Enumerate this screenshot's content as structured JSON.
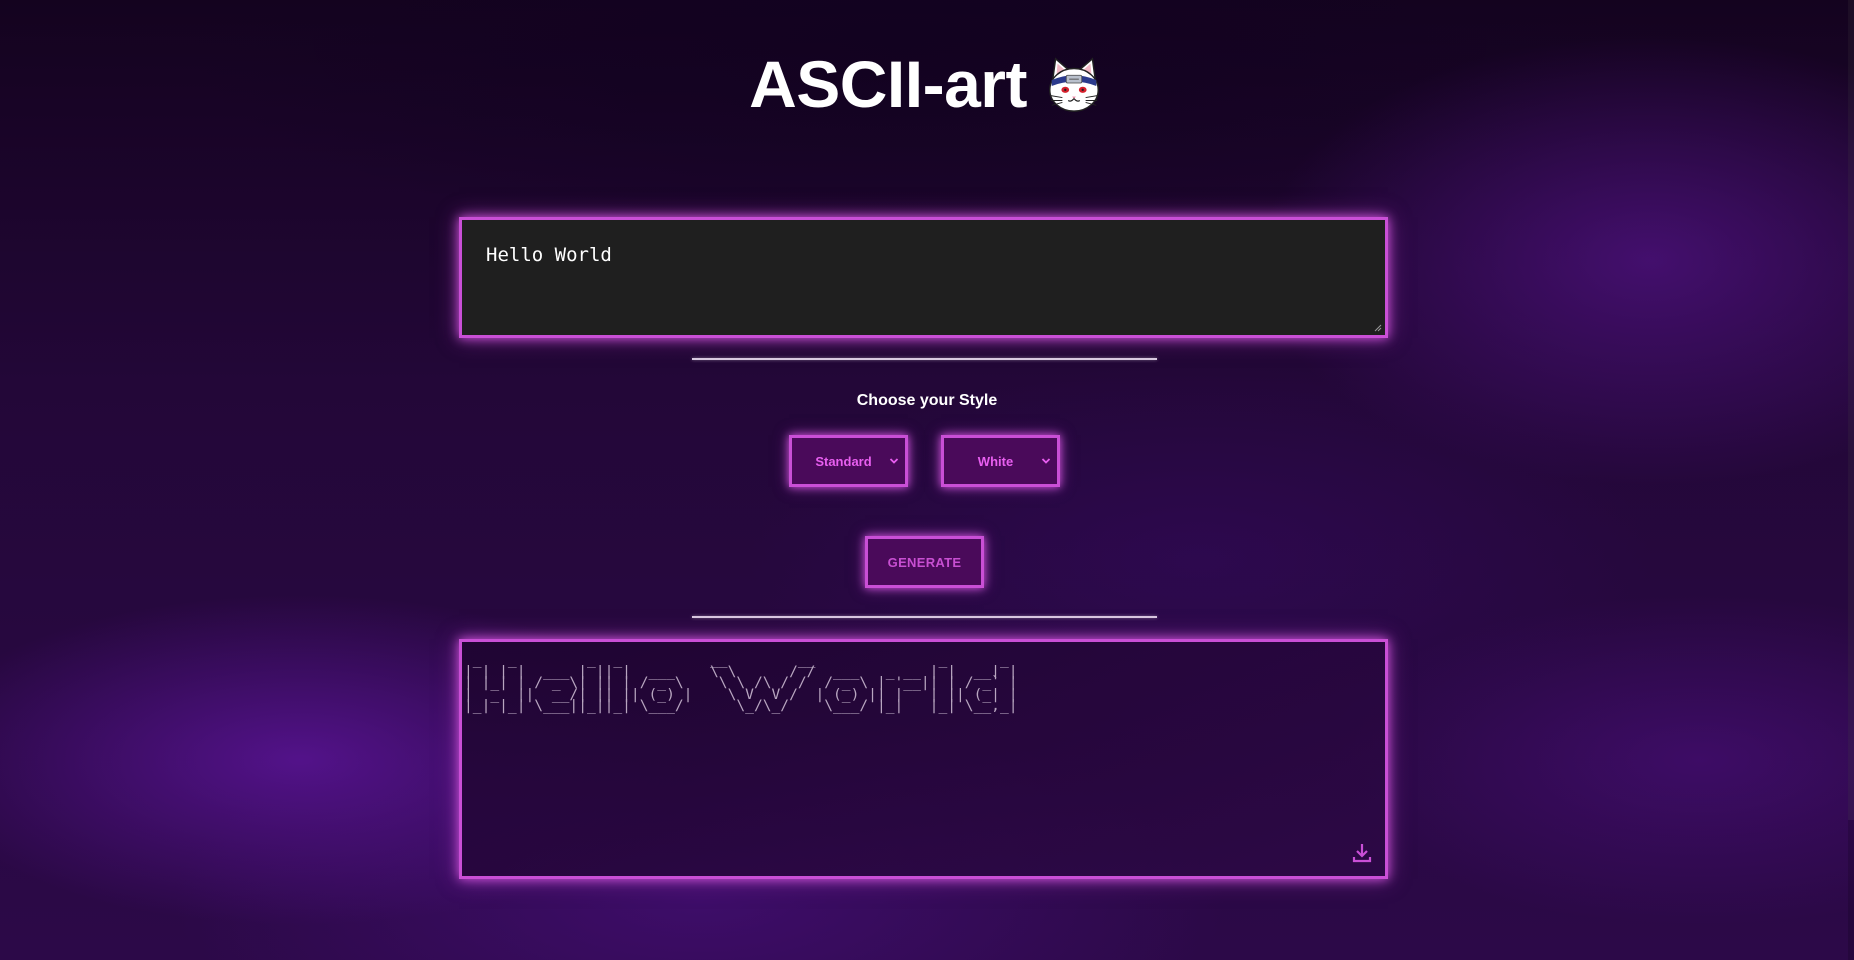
{
  "header": {
    "title": "ASCII-art",
    "logo_icon": "cat-face-icon"
  },
  "input": {
    "value": "Hello World"
  },
  "style_section": {
    "label": "Choose your Style",
    "font_select": {
      "selected": "Standard"
    },
    "color_select": {
      "selected": "White"
    }
  },
  "generate_button": {
    "label": "GENERATE"
  },
  "output": {
    "ascii_text": " _   _        _  _          __        __              _      _ \n| | | |  ___ | || |  ___    \\ \\      / /  ___   _ __ | |  __| |\n| |_| | / _ \\| || | / _ \\    \\ \\ /\\ / /  / _ \\ | '__|| | / _` |\n|  _  ||  __/| || || (_) |    \\ V  V /  | (_) || |   | || (_| |\n|_| |_| \\___||_||_| \\___/      \\_/\\_/    \\___/ |_|   |_| \\__,_|",
    "download_icon": "download-icon"
  },
  "colors": {
    "accent": "#c94fd6",
    "button_bg": "#4a0a5a",
    "select_text": "#e85ff0",
    "input_bg": "#1f1f1f",
    "ascii_text": "#b8a6c0"
  }
}
